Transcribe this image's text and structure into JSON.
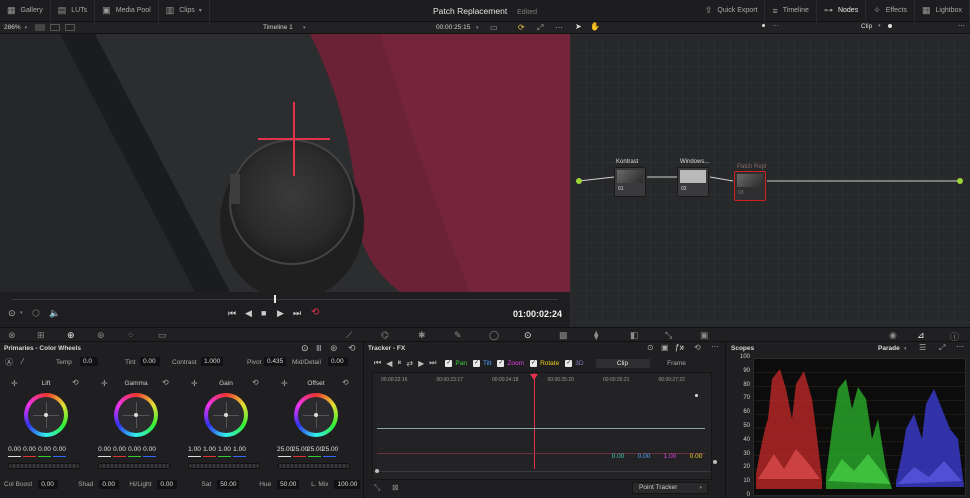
{
  "topbar": {
    "left": [
      {
        "icon": "gallery-icon",
        "glyph": "▦",
        "label": "Gallery"
      },
      {
        "icon": "luts-icon",
        "glyph": "▤",
        "label": "LUTs"
      },
      {
        "icon": "media-pool-icon",
        "glyph": "▣",
        "label": "Media Pool"
      },
      {
        "icon": "clips-icon",
        "glyph": "▥",
        "label": "Clips"
      }
    ],
    "project_title": "Patch Replacement",
    "project_status": "Edited",
    "right": [
      {
        "icon": "quick-export-icon",
        "glyph": "⇪",
        "label": "Quick Export"
      },
      {
        "icon": "timeline-icon",
        "glyph": "≡",
        "label": "Timeline"
      },
      {
        "icon": "nodes-icon",
        "glyph": "⊶",
        "label": "Nodes"
      },
      {
        "icon": "effects-icon",
        "glyph": "✧",
        "label": "Effects"
      },
      {
        "icon": "lightbox-icon",
        "glyph": "▦",
        "label": "Lightbox"
      }
    ]
  },
  "viewer": {
    "zoom": "286%",
    "timeline_name": "Timeline 1",
    "timecode_top": "00:00:25:15",
    "timecode_main": "01:00:02:24",
    "playhead_fraction": 0.48
  },
  "nodes_panel": {
    "mode": "Clip",
    "nodes": [
      {
        "label": "Kontrast",
        "num": "01"
      },
      {
        "label": "Windows...",
        "num": "02"
      },
      {
        "label": "Patch Repl",
        "num": "03"
      }
    ]
  },
  "primaries": {
    "title": "Primaries - Color Wheels",
    "temp_label": "Temp",
    "temp": "0.0",
    "tint_label": "Tint",
    "tint": "0.00",
    "contrast_label": "Contrast",
    "contrast": "1.000",
    "pivot_label": "Pivot",
    "pivot": "0.435",
    "middetail_label": "Mid/Detail",
    "middetail": "0.00",
    "wheels": [
      {
        "name": "Lift",
        "values": [
          "0.00",
          "0.00",
          "0.00",
          "0.00"
        ]
      },
      {
        "name": "Gamma",
        "values": [
          "0.00",
          "0.00",
          "0.00",
          "0.00"
        ]
      },
      {
        "name": "Gain",
        "values": [
          "1.00",
          "1.00",
          "1.00",
          "1.00"
        ]
      },
      {
        "name": "Offset",
        "values": [
          "25.00",
          "25.00",
          "25.00",
          "25.00"
        ]
      }
    ],
    "colboost_label": "Col Boost",
    "colboost": "0.00",
    "shad_label": "Shad",
    "shad": "0.00",
    "hilight_label": "Hi/Light",
    "hilight": "0.00",
    "sat_label": "Sat",
    "sat": "50.00",
    "hue_label": "Hue",
    "hue": "50.00",
    "lmix_label": "L. Mix",
    "lmix": "100.00"
  },
  "tracker": {
    "title": "Tracker - FX",
    "pan": "Pan",
    "tilt": "Tilt",
    "zoom": "Zoom",
    "rotate": "Rotate",
    "d3": "3D",
    "clip_tab": "Clip",
    "frame_tab": "Frame",
    "ticks": [
      "00:00:22:16",
      "00:00:23:17",
      "00:00:24:18",
      "00:00:25:20",
      "00:00:26:21",
      "00:00:27:22"
    ],
    "readout": [
      "0.00",
      "0.00",
      "1.00",
      "0.00"
    ],
    "tracker_type": "Point Tracker",
    "colors": {
      "pan": "#39d03c",
      "tilt": "#4da3ff",
      "zoom": "#e040e0",
      "rotate": "#f0d020"
    }
  },
  "scopes": {
    "title": "Scopes",
    "mode": "Parade",
    "scale": [
      "100",
      "90",
      "80",
      "70",
      "60",
      "50",
      "40",
      "30",
      "20",
      "10",
      "0"
    ]
  }
}
